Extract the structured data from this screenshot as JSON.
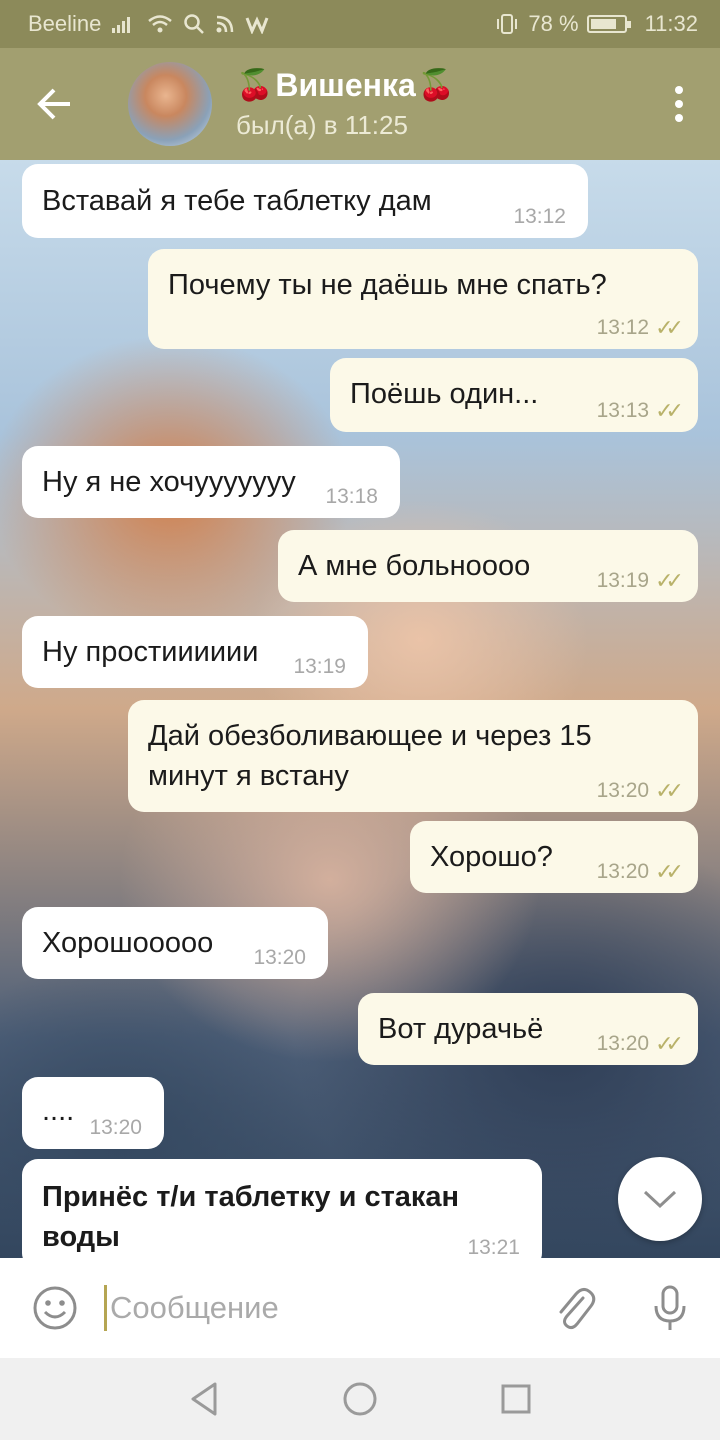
{
  "status_bar": {
    "carrier": "Beeline",
    "battery": "78 %",
    "battery_level": 0.78,
    "time": "11:32"
  },
  "header": {
    "name": "Вишенка",
    "status": "был(а) в 11:25"
  },
  "messages": [
    {
      "direction": "in",
      "text": "Вставай я тебе таблетку дам",
      "time": "13:12"
    },
    {
      "direction": "out",
      "text": "Почему ты не даёшь мне спать?",
      "time": "13:12"
    },
    {
      "direction": "out",
      "text": "Поёшь один...",
      "time": "13:13"
    },
    {
      "direction": "in",
      "text": "Ну я не хочууууууу",
      "time": "13:18"
    },
    {
      "direction": "out",
      "text": "А мне больнoooo",
      "time": "13:19"
    },
    {
      "direction": "in",
      "text": "Ну простииииии",
      "time": "13:19"
    },
    {
      "direction": "out",
      "text": "Дай обезболивающее и через 15 минут я встану",
      "time": "13:20"
    },
    {
      "direction": "out",
      "text": "Хорошо?",
      "time": "13:20"
    },
    {
      "direction": "in",
      "text": "Хорошооооо",
      "time": "13:20"
    },
    {
      "direction": "out",
      "text": "Вот дурачьё",
      "time": "13:20"
    },
    {
      "direction": "in",
      "text": "....",
      "time": "13:20"
    },
    {
      "direction": "in",
      "text": "Принёс т/и таблетку и стакан воды",
      "time": "13:21"
    }
  ],
  "input": {
    "placeholder": "Сообщение"
  },
  "colors": {
    "header": "#a29f70",
    "status_bar": "#8c8a5a",
    "incoming_bubble": "#ffffff",
    "outgoing_bubble": "#fcf9e8",
    "read_check": "#b9b26a"
  }
}
